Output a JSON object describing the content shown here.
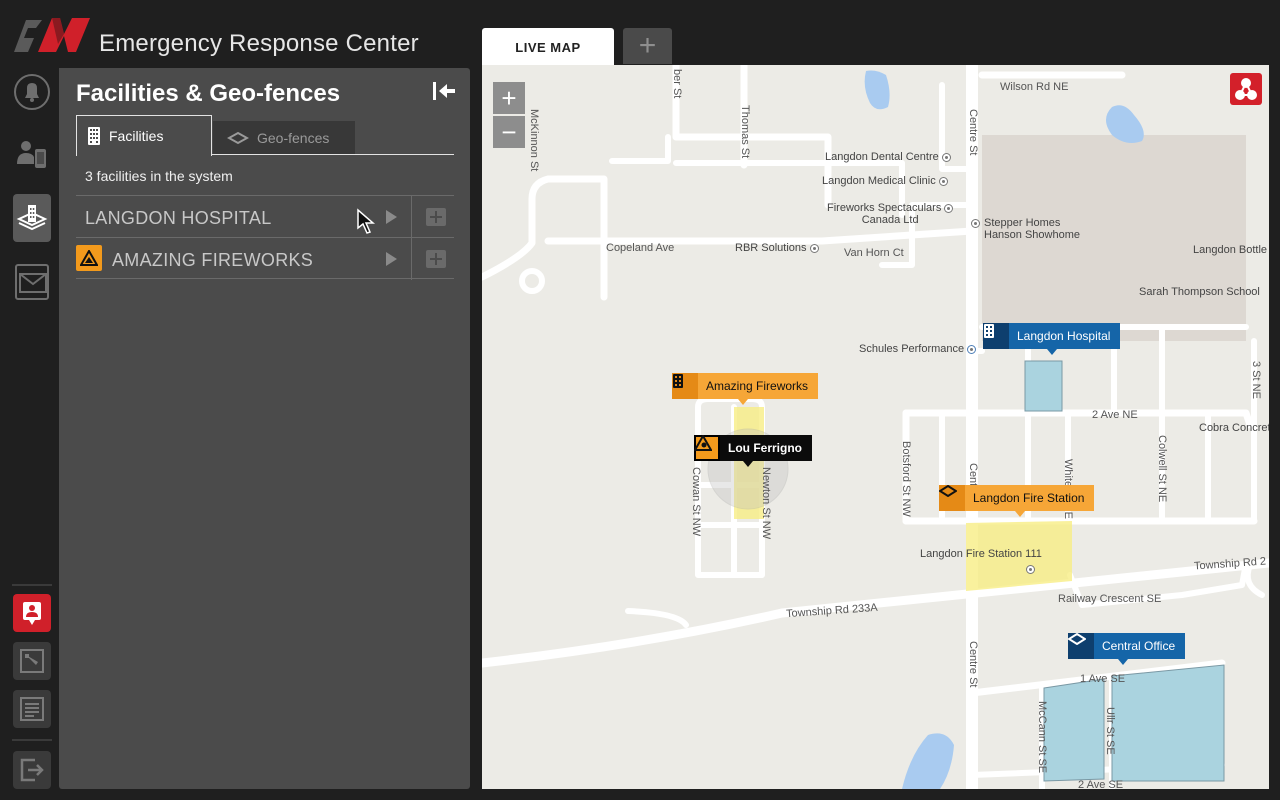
{
  "app": {
    "title": "Emergency Response Center"
  },
  "panel": {
    "title": "Facilities & Geo-fences",
    "tabs": [
      {
        "label": "Facilities"
      },
      {
        "label": "Geo-fences"
      }
    ],
    "count_text": "3 facilities in the system",
    "facilities": [
      {
        "name": "LANGDON HOSPITAL"
      },
      {
        "name": "AMAZING FIREWORKS"
      }
    ]
  },
  "map_tabs": {
    "live": "LIVE MAP",
    "add": "+"
  },
  "map": {
    "zoom_in": "+",
    "zoom_out": "−",
    "streets": {
      "wilson": "Wilson Rd NE",
      "centre_top": "Centre St",
      "centre_mid": "Centre St",
      "centre_bot": "Centre St",
      "thomas": "Thomas St",
      "mckinnon": "McKinnon St",
      "ber": "ber St",
      "copeland": "Copeland Ave",
      "vanhorn": "Van Horn Ct",
      "ave2": "2 Ave NE",
      "botsford": "Botsford St NW",
      "colwell": "Colwell St NE",
      "white": "White St NE",
      "third": "3 St NE",
      "cowan": "Cowan St NW",
      "newton": "Newton St NW",
      "twp233a": "Township Rd 233A",
      "twp2": "Township Rd 2",
      "railway": "Railway Crescent SE",
      "ave1": "1 Ave SE",
      "ave2se": "2 Ave SE",
      "mccann": "McCann St SE",
      "ullr": "Ullr St SE"
    },
    "pois": {
      "dental": "Langdon Dental Centre",
      "medical": "Langdon Medical Clinic",
      "fireworks_spec": "Fireworks Spectaculars",
      "fireworks_spec2": "Canada Ltd",
      "rbr": "RBR Solutions",
      "stepper": "Stepper Homes",
      "stepper2": "Hanson Showhome",
      "bottle": "Langdon Bottle",
      "sarah": "Sarah Thompson School",
      "schules": "Schules Performance",
      "cobra": "Cobra Concret",
      "fire111": "Langdon Fire Station 111"
    },
    "markers": {
      "hospital": "Langdon Hospital",
      "fireworks": "Amazing Fireworks",
      "person": "Lou Ferrigno",
      "fire_station": "Langdon Fire Station",
      "central": "Central Office"
    }
  },
  "colors": {
    "accent_red": "#d0202a",
    "marker_blue": "#1565a8",
    "marker_orange": "#f6a637",
    "geofence_yellow": "#f7ee84",
    "building_blue": "#aad3df"
  }
}
